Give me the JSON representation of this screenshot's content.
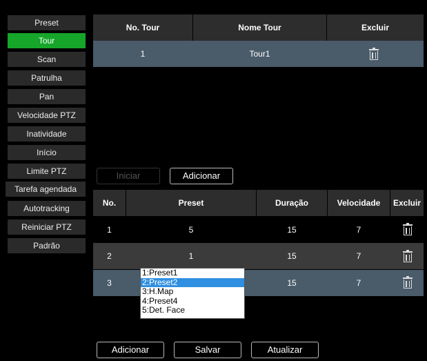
{
  "sidebar": {
    "items": [
      {
        "label": "Preset"
      },
      {
        "label": "Tour"
      },
      {
        "label": "Scan"
      },
      {
        "label": "Patrulha"
      },
      {
        "label": "Pan"
      },
      {
        "label": "Velocidade PTZ"
      },
      {
        "label": "Inatividade"
      },
      {
        "label": "Início"
      },
      {
        "label": "Limite PTZ"
      },
      {
        "label": "Tarefa agendada"
      },
      {
        "label": "Autotracking"
      },
      {
        "label": "Reiniciar PTZ"
      },
      {
        "label": "Padrão"
      }
    ],
    "active": "Tour"
  },
  "tour_table": {
    "headers": [
      "No. Tour",
      "Nome Tour",
      "Excluir"
    ],
    "rows": [
      {
        "no": "1",
        "name": "Tour1",
        "delete_icon": "trash-icon"
      }
    ]
  },
  "tour_buttons": {
    "start": "Iniciar",
    "add": "Adicionar"
  },
  "preset_table": {
    "headers": [
      "No.",
      "Preset",
      "Duração",
      "Velocidade",
      "Excluir"
    ],
    "rows": [
      {
        "no": "1",
        "preset": "5",
        "duration": "15",
        "speed": "7"
      },
      {
        "no": "2",
        "preset": "1",
        "duration": "15",
        "speed": "7"
      },
      {
        "no": "3",
        "preset": "",
        "duration": "15",
        "speed": "7"
      }
    ]
  },
  "preset_dropdown": {
    "options": [
      "1:Preset1",
      "2:Preset2",
      "3:H.Map",
      "4:Preset4",
      "5:Det. Face"
    ],
    "selected": "2:Preset2"
  },
  "bottom_buttons": {
    "add": "Adicionar",
    "save": "Salvar",
    "refresh": "Atualizar"
  },
  "colors": {
    "active_green": "#16a62a",
    "row_highlight": "#4a5b6a",
    "selection_blue": "#2f8fe0"
  }
}
